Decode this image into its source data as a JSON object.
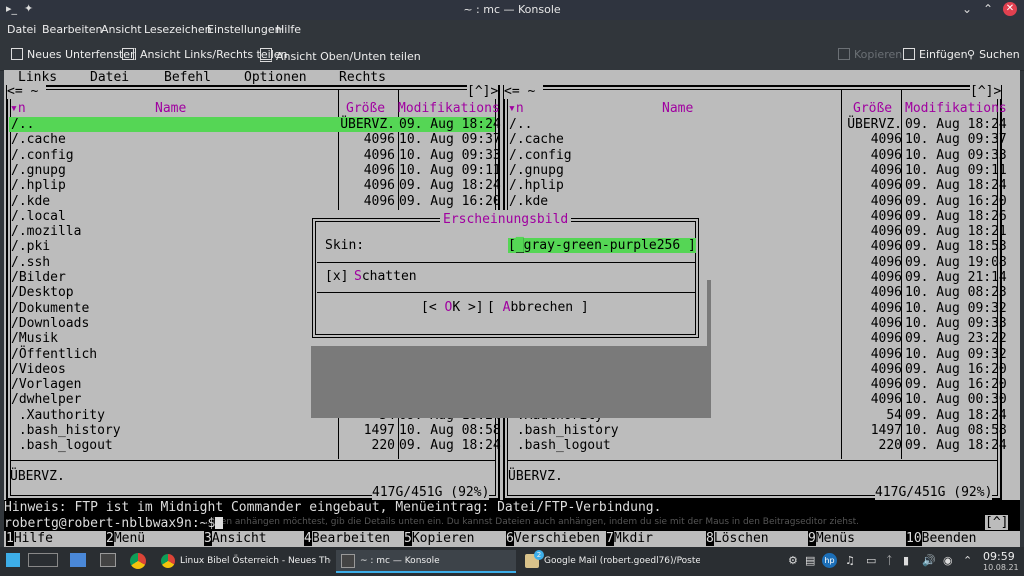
{
  "window": {
    "title": "~ : mc — Konsole"
  },
  "menubar": [
    "Datei",
    "Bearbeiten",
    "Ansicht",
    "Lesezeichen",
    "Einstellungen",
    "Hilfe"
  ],
  "toolbar": {
    "new_tab": "Neues Unterfenster",
    "split_lr": "Ansicht Links/Rechts teilen",
    "split_tb": "Ansicht Oben/Unten teilen",
    "copy": "Kopieren",
    "paste": "Einfügen",
    "search": "Suchen"
  },
  "mc": {
    "menu": [
      "Links",
      "Datei",
      "Befehl",
      "Optionen",
      "Rechts"
    ],
    "panel_path": "~",
    "panel_path_right": "[^]>",
    "headers": {
      "sort": "▾n",
      "name": "Name",
      "size": "Größe",
      "mod": "Modifikations"
    },
    "left_files": [
      {
        "n": "/..",
        "s": "ÜBERVZ.",
        "m": "09. Aug 18:24"
      },
      {
        "n": "/.cache",
        "s": "4096",
        "m": "10. Aug 09:37"
      },
      {
        "n": "/.config",
        "s": "4096",
        "m": "10. Aug 09:33"
      },
      {
        "n": "/.gnupg",
        "s": "4096",
        "m": "10. Aug 09:11"
      },
      {
        "n": "/.hplip",
        "s": "4096",
        "m": "09. Aug 18:24"
      },
      {
        "n": "/.kde",
        "s": "4096",
        "m": "09. Aug 16:20"
      },
      {
        "n": "/.local",
        "s": "",
        "m": ""
      },
      {
        "n": "/.mozilla",
        "s": "",
        "m": ""
      },
      {
        "n": "/.pki",
        "s": "",
        "m": ""
      },
      {
        "n": "/.ssh",
        "s": "",
        "m": ""
      },
      {
        "n": "/Bilder",
        "s": "",
        "m": ""
      },
      {
        "n": "/Desktop",
        "s": "",
        "m": ""
      },
      {
        "n": "/Dokumente",
        "s": "",
        "m": ""
      },
      {
        "n": "/Downloads",
        "s": "",
        "m": ""
      },
      {
        "n": "/Musik",
        "s": "",
        "m": ""
      },
      {
        "n": "/Öffentlich",
        "s": "4096",
        "m": "10. Aug 09:32"
      },
      {
        "n": "/Videos",
        "s": "4096",
        "m": "09. Aug 16:20"
      },
      {
        "n": "/Vorlagen",
        "s": "4096",
        "m": "09. Aug 16:20"
      },
      {
        "n": "/dwhelper",
        "s": "4096",
        "m": "10. Aug 00:30"
      },
      {
        "n": " .Xauthority",
        "s": "54",
        "m": "09. Aug 18:24"
      },
      {
        "n": " .bash_history",
        "s": "1497",
        "m": "10. Aug 08:58"
      },
      {
        "n": " .bash_logout",
        "s": "220",
        "m": "09. Aug 18:24"
      }
    ],
    "right_files": [
      {
        "n": "/..",
        "s": "ÜBERVZ.",
        "m": "09. Aug 18:24"
      },
      {
        "n": "/.cache",
        "s": "4096",
        "m": "10. Aug 09:37"
      },
      {
        "n": "/.config",
        "s": "4096",
        "m": "10. Aug 09:33"
      },
      {
        "n": "/.gnupg",
        "s": "4096",
        "m": "10. Aug 09:11"
      },
      {
        "n": "/.hplip",
        "s": "4096",
        "m": "09. Aug 18:24"
      },
      {
        "n": "/.kde",
        "s": "4096",
        "m": "09. Aug 16:20"
      },
      {
        "n": "",
        "s": "4096",
        "m": "09. Aug 18:26"
      },
      {
        "n": "",
        "s": "4096",
        "m": "09. Aug 18:21"
      },
      {
        "n": "",
        "s": "4096",
        "m": "09. Aug 18:53"
      },
      {
        "n": "",
        "s": "4096",
        "m": "09. Aug 19:08"
      },
      {
        "n": "",
        "s": "4096",
        "m": "09. Aug 21:14"
      },
      {
        "n": "",
        "s": "4096",
        "m": "10. Aug 08:23"
      },
      {
        "n": "",
        "s": "4096",
        "m": "10. Aug 09:32"
      },
      {
        "n": "",
        "s": "4096",
        "m": "10. Aug 09:33"
      },
      {
        "n": "",
        "s": "4096",
        "m": "09. Aug 23:22"
      },
      {
        "n": "/Öffentlich",
        "s": "4096",
        "m": "10. Aug 09:32"
      },
      {
        "n": "/Videos",
        "s": "4096",
        "m": "09. Aug 16:20"
      },
      {
        "n": "/Vorlagen",
        "s": "4096",
        "m": "09. Aug 16:20"
      },
      {
        "n": "/dwhelper",
        "s": "4096",
        "m": "10. Aug 00:30"
      },
      {
        "n": " .Xauthority",
        "s": "54",
        "m": "09. Aug 18:24"
      },
      {
        "n": " .bash_history",
        "s": "1497",
        "m": "10. Aug 08:58"
      },
      {
        "n": " .bash_logout",
        "s": "220",
        "m": "09. Aug 18:24"
      }
    ],
    "status_left": "ÜBERVZ.",
    "status_right": "ÜBERVZ.",
    "free_left": "417G/451G (92%)",
    "free_right": "417G/451G (92%)",
    "hint": "Hinweis: FTP ist im Midnight Commander eingebaut, Menüeintrag: Datei/FTP-Verbindung.",
    "prompt": "robertg@robert-nblbwax9n:~$",
    "prompt_overlay": "...inen anhängen möchtest, gib die Details unten ein. Du kannst Dateien auch anhängen, indem du sie mit der Maus in den Beitragseditor ziehst.",
    "history_btn": "[^]",
    "fkeys": [
      {
        "n": "1",
        "l": "Hilfe"
      },
      {
        "n": "2",
        "l": "Menü"
      },
      {
        "n": "3",
        "l": "Ansicht"
      },
      {
        "n": "4",
        "l": "Bearbeiten"
      },
      {
        "n": "5",
        "l": "Kopieren"
      },
      {
        "n": "6",
        "l": "Verschieben"
      },
      {
        "n": "7",
        "l": "Mkdir"
      },
      {
        "n": "8",
        "l": "Löschen"
      },
      {
        "n": "9",
        "l": "Menüs"
      },
      {
        "n": "10",
        "l": "Beenden"
      }
    ]
  },
  "dialog": {
    "title": "Erscheinungsbild",
    "skin_label": "Skin:",
    "skin_value": "gray-green-purple256 ]",
    "shadow_check": "[x]",
    "shadow_label": "Schatten",
    "ok": "[< OK >]",
    "cancel": "[ Abbrechen ]"
  },
  "taskbar": {
    "tasks": [
      "Linux Bibel Österreich - Neues The...",
      "~ : mc — Konsole",
      "Google Mail (robert.goedl76)/Poste..."
    ],
    "mail_badge": "2",
    "time": "09:59",
    "date": "10.08.21"
  },
  "colors": {
    "terminal_bg": "#bcbcbc",
    "selection": "#55d655",
    "accent": "#a000a0",
    "active_task": "#3daee9"
  }
}
